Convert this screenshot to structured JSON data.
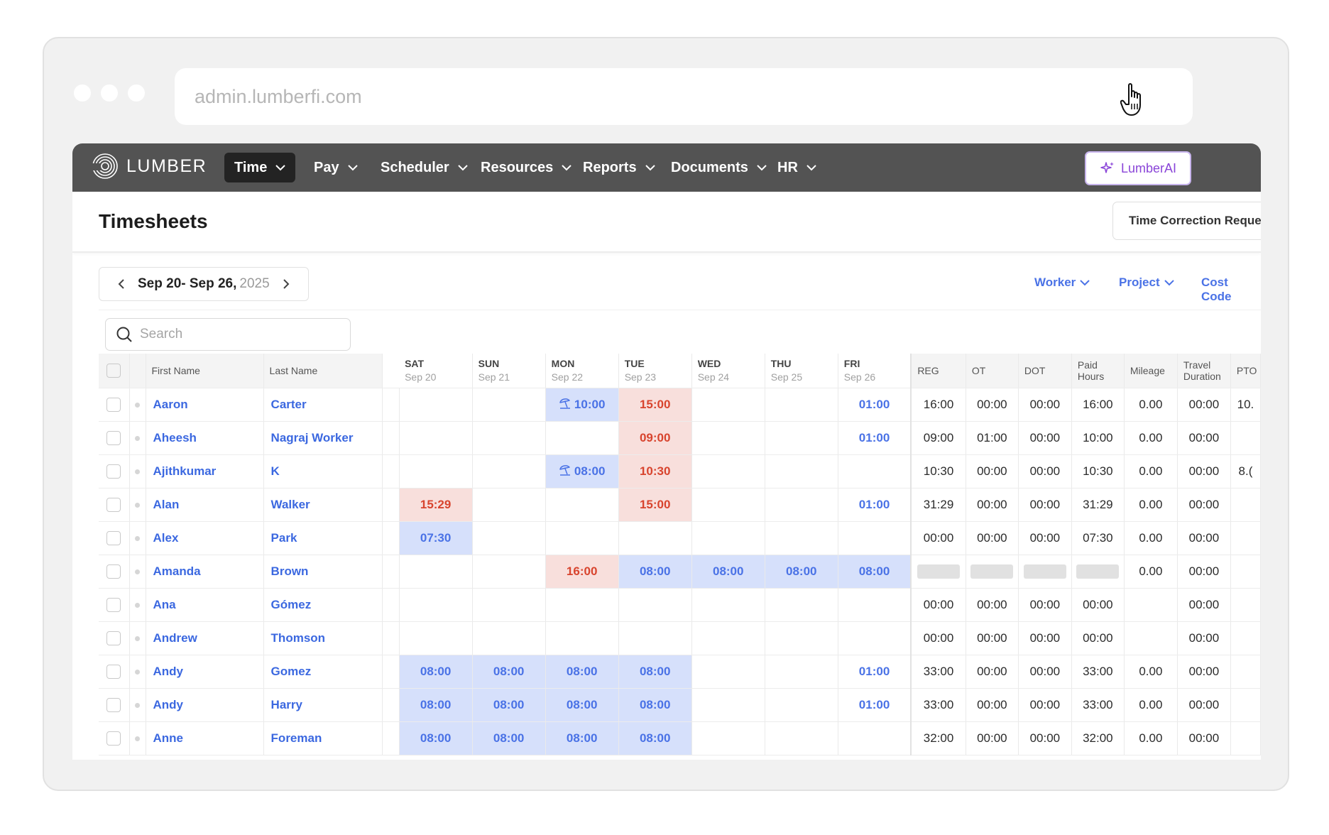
{
  "browser": {
    "url": "admin.lumberfi.com"
  },
  "brand": {
    "name": "LUMBER"
  },
  "nav": [
    {
      "label": "Time",
      "active": true
    },
    {
      "label": "Pay"
    },
    {
      "label": "Scheduler"
    },
    {
      "label": "Resources"
    },
    {
      "label": "Reports"
    },
    {
      "label": "Documents"
    },
    {
      "label": "HR"
    }
  ],
  "ai_button": {
    "label": "LumberAI"
  },
  "header": {
    "title": "Timesheets",
    "action_label": "Time Correction Reques"
  },
  "date_range": {
    "dates": "Sep 20- Sep 26,",
    "year": "2025"
  },
  "filters": [
    {
      "label": "Worker"
    },
    {
      "label": "Project"
    },
    {
      "label": "Cost Code"
    }
  ],
  "search": {
    "placeholder": "Search"
  },
  "columns": {
    "first_name": "First Name",
    "last_name": "Last Name",
    "days": [
      {
        "name": "SAT",
        "date": "Sep 20"
      },
      {
        "name": "SUN",
        "date": "Sep 21"
      },
      {
        "name": "MON",
        "date": "Sep 22"
      },
      {
        "name": "TUE",
        "date": "Sep 23"
      },
      {
        "name": "WED",
        "date": "Sep 24"
      },
      {
        "name": "THU",
        "date": "Sep 25"
      },
      {
        "name": "FRI",
        "date": "Sep 26"
      }
    ],
    "totals": [
      {
        "line1": "REG",
        "line2": ""
      },
      {
        "line1": "OT",
        "line2": ""
      },
      {
        "line1": "DOT",
        "line2": ""
      },
      {
        "line1": "Paid",
        "line2": "Hours"
      },
      {
        "line1": "Mileage",
        "line2": ""
      },
      {
        "line1": "Travel",
        "line2": "Duration"
      },
      {
        "line1": "PTO",
        "line2": ""
      }
    ]
  },
  "rows": [
    {
      "first": "Aaron",
      "last": "Carter",
      "days": [
        {
          "v": "",
          "s": ""
        },
        {
          "v": "",
          "s": ""
        },
        {
          "v": "10:00",
          "s": "blue",
          "pto": true
        },
        {
          "v": "15:00",
          "s": "red"
        },
        {
          "v": "",
          "s": ""
        },
        {
          "v": "",
          "s": ""
        },
        {
          "v": "01:00",
          "s": "plain"
        }
      ],
      "totals": [
        "16:00",
        "00:00",
        "00:00",
        "16:00",
        "0.00",
        "00:00",
        "10."
      ]
    },
    {
      "first": "Aheesh",
      "last": "Nagraj Worker",
      "days": [
        {
          "v": "",
          "s": ""
        },
        {
          "v": "",
          "s": ""
        },
        {
          "v": "",
          "s": ""
        },
        {
          "v": "09:00",
          "s": "red"
        },
        {
          "v": "",
          "s": ""
        },
        {
          "v": "",
          "s": ""
        },
        {
          "v": "01:00",
          "s": "plain"
        }
      ],
      "totals": [
        "09:00",
        "01:00",
        "00:00",
        "10:00",
        "0.00",
        "00:00",
        ""
      ]
    },
    {
      "first": "Ajithkumar",
      "last": "K",
      "days": [
        {
          "v": "",
          "s": ""
        },
        {
          "v": "",
          "s": ""
        },
        {
          "v": "08:00",
          "s": "blue",
          "pto": true
        },
        {
          "v": "10:30",
          "s": "red"
        },
        {
          "v": "",
          "s": ""
        },
        {
          "v": "",
          "s": ""
        },
        {
          "v": "",
          "s": ""
        }
      ],
      "totals": [
        "10:30",
        "00:00",
        "00:00",
        "10:30",
        "0.00",
        "00:00",
        "8.("
      ]
    },
    {
      "first": "Alan",
      "last": "Walker",
      "days": [
        {
          "v": "15:29",
          "s": "red"
        },
        {
          "v": "",
          "s": ""
        },
        {
          "v": "",
          "s": ""
        },
        {
          "v": "15:00",
          "s": "red"
        },
        {
          "v": "",
          "s": ""
        },
        {
          "v": "",
          "s": ""
        },
        {
          "v": "01:00",
          "s": "plain"
        }
      ],
      "totals": [
        "31:29",
        "00:00",
        "00:00",
        "31:29",
        "0.00",
        "00:00",
        ""
      ]
    },
    {
      "first": "Alex",
      "last": "Park",
      "days": [
        {
          "v": "07:30",
          "s": "blue"
        },
        {
          "v": "",
          "s": ""
        },
        {
          "v": "",
          "s": ""
        },
        {
          "v": "",
          "s": ""
        },
        {
          "v": "",
          "s": ""
        },
        {
          "v": "",
          "s": ""
        },
        {
          "v": "",
          "s": ""
        }
      ],
      "totals": [
        "00:00",
        "00:00",
        "00:00",
        "07:30",
        "0.00",
        "00:00",
        ""
      ]
    },
    {
      "first": "Amanda",
      "last": "Brown",
      "days": [
        {
          "v": "",
          "s": ""
        },
        {
          "v": "",
          "s": ""
        },
        {
          "v": "16:00",
          "s": "red"
        },
        {
          "v": "08:00",
          "s": "blue"
        },
        {
          "v": "08:00",
          "s": "blue"
        },
        {
          "v": "08:00",
          "s": "blue"
        },
        {
          "v": "08:00",
          "s": "blue"
        }
      ],
      "totals": [
        "",
        "",
        "",
        "",
        "0.00",
        "00:00",
        ""
      ],
      "loading": true
    },
    {
      "first": "Ana",
      "last": "Gómez",
      "days": [
        {
          "v": "",
          "s": ""
        },
        {
          "v": "",
          "s": ""
        },
        {
          "v": "",
          "s": ""
        },
        {
          "v": "",
          "s": ""
        },
        {
          "v": "",
          "s": ""
        },
        {
          "v": "",
          "s": ""
        },
        {
          "v": "",
          "s": ""
        }
      ],
      "totals": [
        "00:00",
        "00:00",
        "00:00",
        "00:00",
        "",
        "00:00",
        ""
      ]
    },
    {
      "first": "Andrew",
      "last": "Thomson",
      "days": [
        {
          "v": "",
          "s": ""
        },
        {
          "v": "",
          "s": ""
        },
        {
          "v": "",
          "s": ""
        },
        {
          "v": "",
          "s": ""
        },
        {
          "v": "",
          "s": ""
        },
        {
          "v": "",
          "s": ""
        },
        {
          "v": "",
          "s": ""
        }
      ],
      "totals": [
        "00:00",
        "00:00",
        "00:00",
        "00:00",
        "",
        "00:00",
        ""
      ]
    },
    {
      "first": "Andy",
      "last": "Gomez",
      "days": [
        {
          "v": "08:00",
          "s": "blue"
        },
        {
          "v": "08:00",
          "s": "blue"
        },
        {
          "v": "08:00",
          "s": "blue"
        },
        {
          "v": "08:00",
          "s": "blue"
        },
        {
          "v": "",
          "s": ""
        },
        {
          "v": "",
          "s": ""
        },
        {
          "v": "01:00",
          "s": "plain"
        }
      ],
      "totals": [
        "33:00",
        "00:00",
        "00:00",
        "33:00",
        "0.00",
        "00:00",
        ""
      ]
    },
    {
      "first": "Andy",
      "last": "Harry",
      "days": [
        {
          "v": "08:00",
          "s": "blue"
        },
        {
          "v": "08:00",
          "s": "blue"
        },
        {
          "v": "08:00",
          "s": "blue"
        },
        {
          "v": "08:00",
          "s": "blue"
        },
        {
          "v": "",
          "s": ""
        },
        {
          "v": "",
          "s": ""
        },
        {
          "v": "01:00",
          "s": "plain"
        }
      ],
      "totals": [
        "33:00",
        "00:00",
        "00:00",
        "33:00",
        "0.00",
        "00:00",
        ""
      ]
    },
    {
      "first": "Anne",
      "last": "Foreman",
      "days": [
        {
          "v": "08:00",
          "s": "blue"
        },
        {
          "v": "08:00",
          "s": "blue"
        },
        {
          "v": "08:00",
          "s": "blue"
        },
        {
          "v": "08:00",
          "s": "blue"
        },
        {
          "v": "",
          "s": ""
        },
        {
          "v": "",
          "s": ""
        },
        {
          "v": "",
          "s": ""
        }
      ],
      "totals": [
        "32:00",
        "00:00",
        "00:00",
        "32:00",
        "0.00",
        "00:00",
        ""
      ]
    }
  ]
}
